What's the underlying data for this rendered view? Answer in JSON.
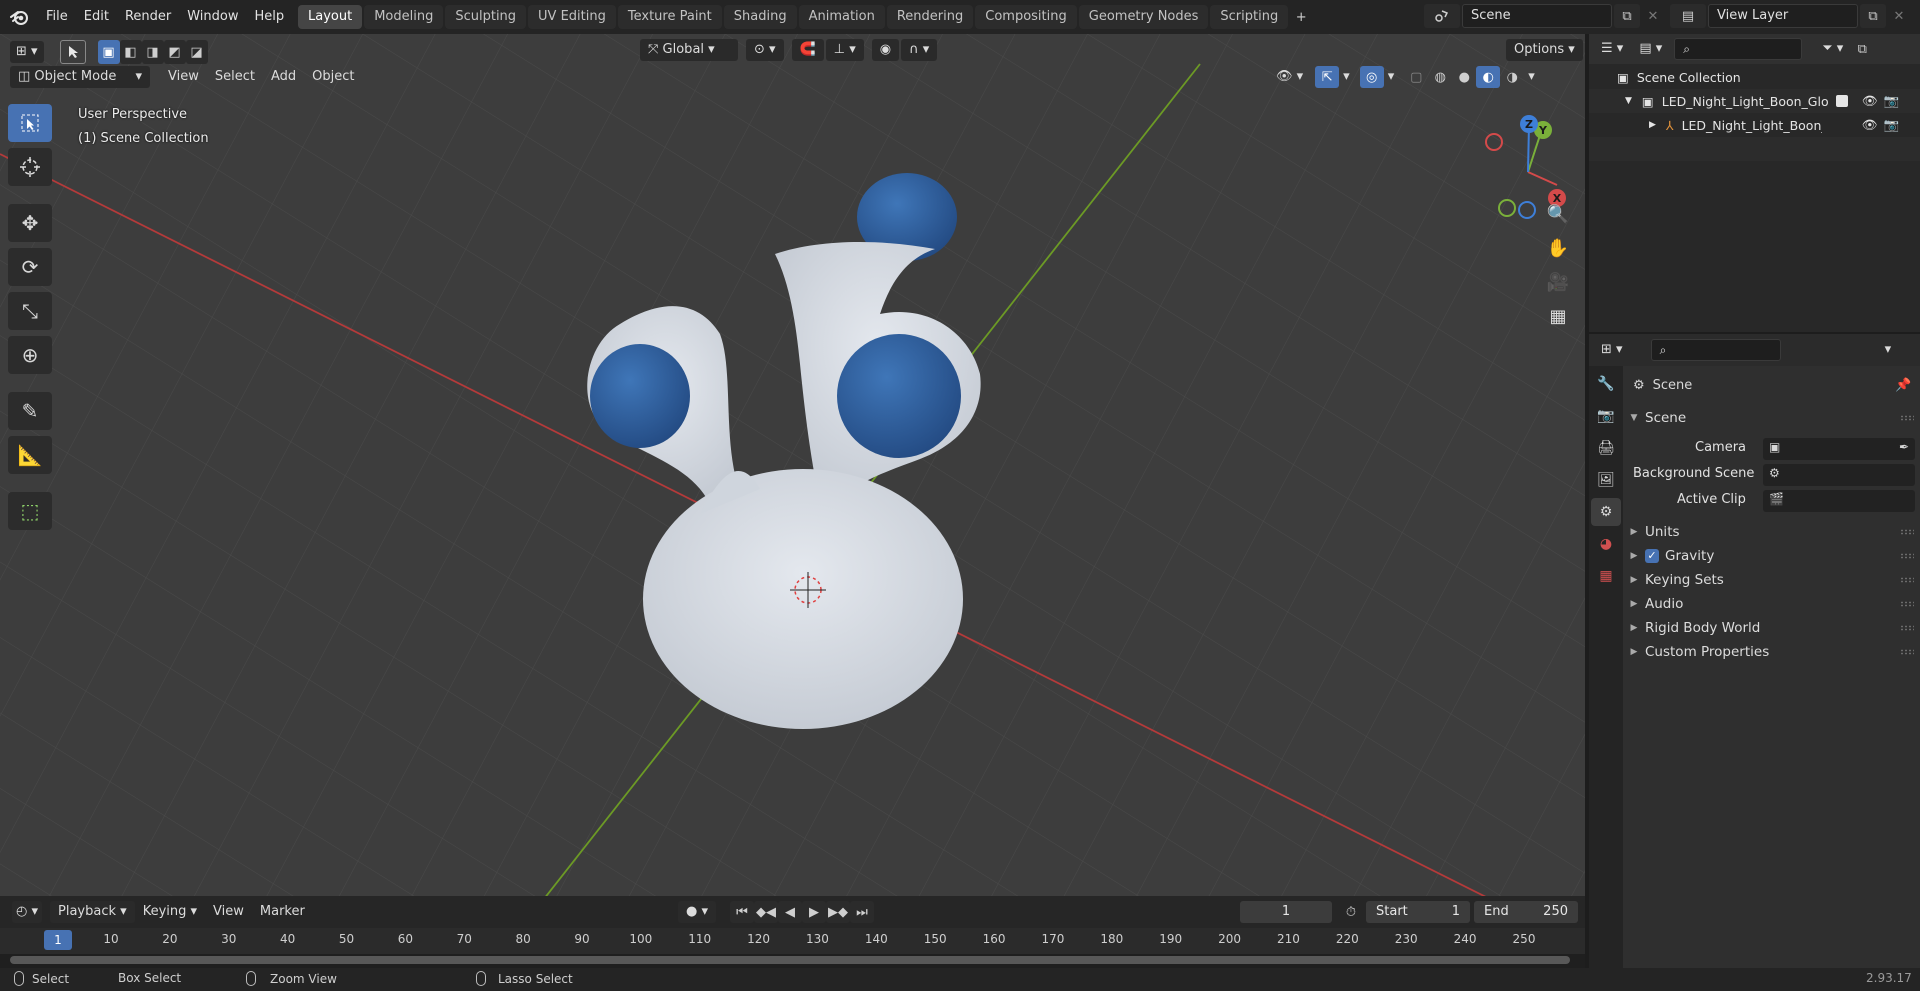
{
  "menu": [
    "File",
    "Edit",
    "Render",
    "Window",
    "Help"
  ],
  "workspaces": [
    "Layout",
    "Modeling",
    "Sculpting",
    "UV Editing",
    "Texture Paint",
    "Shading",
    "Animation",
    "Rendering",
    "Compositing",
    "Geometry Nodes",
    "Scripting"
  ],
  "active_workspace": "Layout",
  "scene_field": "Scene",
  "view_layer_field": "View Layer",
  "viewport": {
    "mode": "Object Mode",
    "menus": [
      "View",
      "Select",
      "Add",
      "Object"
    ],
    "transform_orientation": "Global",
    "options": "Options",
    "overlay_line1": "User Perspective",
    "overlay_line2": "(1) Scene Collection",
    "gizmo": {
      "x": "X",
      "y": "Y",
      "z": "Z"
    }
  },
  "timeline": {
    "menus": [
      "Playback",
      "Keying",
      "View",
      "Marker"
    ],
    "current_frame": "1",
    "start_label": "Start",
    "start_value": "1",
    "end_label": "End",
    "end_value": "250",
    "ticks": [
      "1",
      "10",
      "20",
      "30",
      "40",
      "50",
      "60",
      "70",
      "80",
      "90",
      "100",
      "110",
      "120",
      "130",
      "140",
      "150",
      "160",
      "170",
      "180",
      "190",
      "200",
      "210",
      "220",
      "230",
      "240",
      "250"
    ]
  },
  "statusbar": {
    "select": "Select",
    "box_select": "Box Select",
    "zoom_view": "Zoom View",
    "lasso_select": "Lasso Select",
    "version": "2.93.17"
  },
  "outliner": {
    "root": "Scene Collection",
    "collection": "LED_Night_Light_Boon_Glo_w",
    "object": "LED_Night_Light_Boon_G"
  },
  "properties": {
    "context": "Scene",
    "panel_scene": "Scene",
    "camera_label": "Camera",
    "background_scene_label": "Background Scene",
    "active_clip_label": "Active Clip",
    "sections": [
      "Units",
      "Gravity",
      "Keying Sets",
      "Audio",
      "Rigid Body World",
      "Custom Properties"
    ],
    "gravity_checked": true
  },
  "colors": {
    "accent": "#4772b3",
    "x_axis": "#c03a3a",
    "y_axis": "#6f9a2a",
    "model_body": "#d6dbe3",
    "model_eyes": "#2f5d99"
  }
}
